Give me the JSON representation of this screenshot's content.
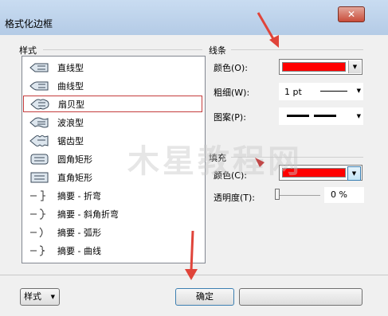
{
  "window": {
    "title": "格式化边框",
    "close_glyph": "✕"
  },
  "style_section": {
    "header": "样式",
    "items": [
      {
        "label": "直线型",
        "icon": "straight-callout-icon",
        "selected": false
      },
      {
        "label": "曲线型",
        "icon": "curved-callout-icon",
        "selected": false
      },
      {
        "label": "扇贝型",
        "icon": "scalloped-callout-icon",
        "selected": true
      },
      {
        "label": "波浪型",
        "icon": "wavy-callout-icon",
        "selected": false
      },
      {
        "label": "锯齿型",
        "icon": "jagged-callout-icon",
        "selected": false
      },
      {
        "label": "圆角矩形",
        "icon": "rounded-rectangle-icon",
        "selected": false
      },
      {
        "label": "直角矩形",
        "icon": "rectangle-icon",
        "selected": false
      },
      {
        "label": "摘要 - 折弯",
        "icon": "summary-bend-icon",
        "selected": false
      },
      {
        "label": "摘要 - 斜角折弯",
        "icon": "summary-bevel-bend-icon",
        "selected": false
      },
      {
        "label": "摘要 - 弧形",
        "icon": "summary-arc-icon",
        "selected": false
      },
      {
        "label": "摘要 - 曲线",
        "icon": "summary-curve-icon",
        "selected": false
      }
    ]
  },
  "line_section": {
    "header": "线条",
    "color_label": "颜色(O):",
    "weight_label": "粗细(W):",
    "weight_value": "1 pt",
    "pattern_label": "图案(P):"
  },
  "fill_section": {
    "header": "填充",
    "color_label": "颜色(C):",
    "transparency_label": "透明度(T):",
    "transparency_value": "0 %"
  },
  "colors": {
    "line_color": "#ff0000",
    "fill_color": "#ff0000",
    "annotation_arrow": "#e0443a"
  },
  "footer": {
    "style_button": "样式",
    "ok_button": "确定"
  },
  "watermark": "木星教程网"
}
